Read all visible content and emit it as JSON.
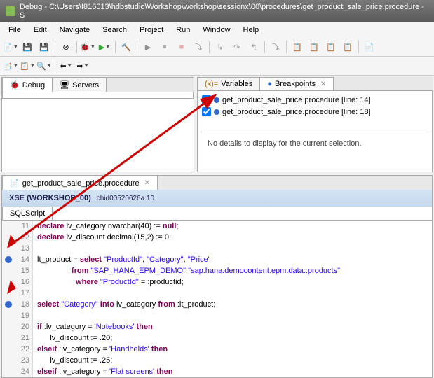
{
  "window": {
    "title": "Debug - C:\\Users\\I816013\\hdbstudio\\Workshop\\workshop\\sessionx\\00\\procedures\\get_product_sale_price.procedure - S"
  },
  "menu": {
    "items": [
      "File",
      "Edit",
      "Navigate",
      "Search",
      "Project",
      "Run",
      "Window",
      "Help"
    ]
  },
  "left_panel": {
    "tabs": [
      {
        "icon": "bug-icon",
        "label": "Debug"
      },
      {
        "icon": "servers-icon",
        "label": "Servers"
      }
    ]
  },
  "right_panel": {
    "tabs": [
      {
        "icon": "variables-icon",
        "label": "Variables"
      },
      {
        "icon": "breakpoints-icon",
        "label": "Breakpoints",
        "active": true
      }
    ],
    "breakpoints": [
      {
        "checked": true,
        "label": "get_product_sale_price.procedure [line: 14]"
      },
      {
        "checked": true,
        "label": "get_product_sale_price.procedure [line: 18]"
      }
    ],
    "detail_message": "No details to display for the current selection."
  },
  "editor": {
    "tab_label": "get_product_sale_price.procedure",
    "title": "XSE (WORKSHOP_00)",
    "subtitle": "chid00520626a 10",
    "script_tab": "SQLScript",
    "lines": [
      {
        "n": 11,
        "text": "declare lv_category nvarchar(40) := null;"
      },
      {
        "n": 12,
        "text": "declare lv_discount decimal(15,2) := 0;"
      },
      {
        "n": 13,
        "text": ""
      },
      {
        "n": 14,
        "bp": true,
        "text": "lt_product = select \"ProductId\", \"Category\", \"Price\""
      },
      {
        "n": 15,
        "text": "                from \"SAP_HANA_EPM_DEMO\".\"sap.hana.democontent.epm.data::products\""
      },
      {
        "n": 16,
        "text": "                  where \"ProductId\" = :productid;"
      },
      {
        "n": 17,
        "text": ""
      },
      {
        "n": 18,
        "bp": true,
        "text": "select \"Category\" into lv_category from :lt_product;"
      },
      {
        "n": 19,
        "text": ""
      },
      {
        "n": 20,
        "text": "if :lv_category = 'Notebooks' then"
      },
      {
        "n": 21,
        "text": "      lv_discount := .20;"
      },
      {
        "n": 22,
        "text": "elseif :lv_category = 'Handhelds' then"
      },
      {
        "n": 23,
        "text": "      lv_discount := .25;"
      },
      {
        "n": 24,
        "text": "elseif :lv_category = 'Flat screens' then"
      }
    ]
  }
}
